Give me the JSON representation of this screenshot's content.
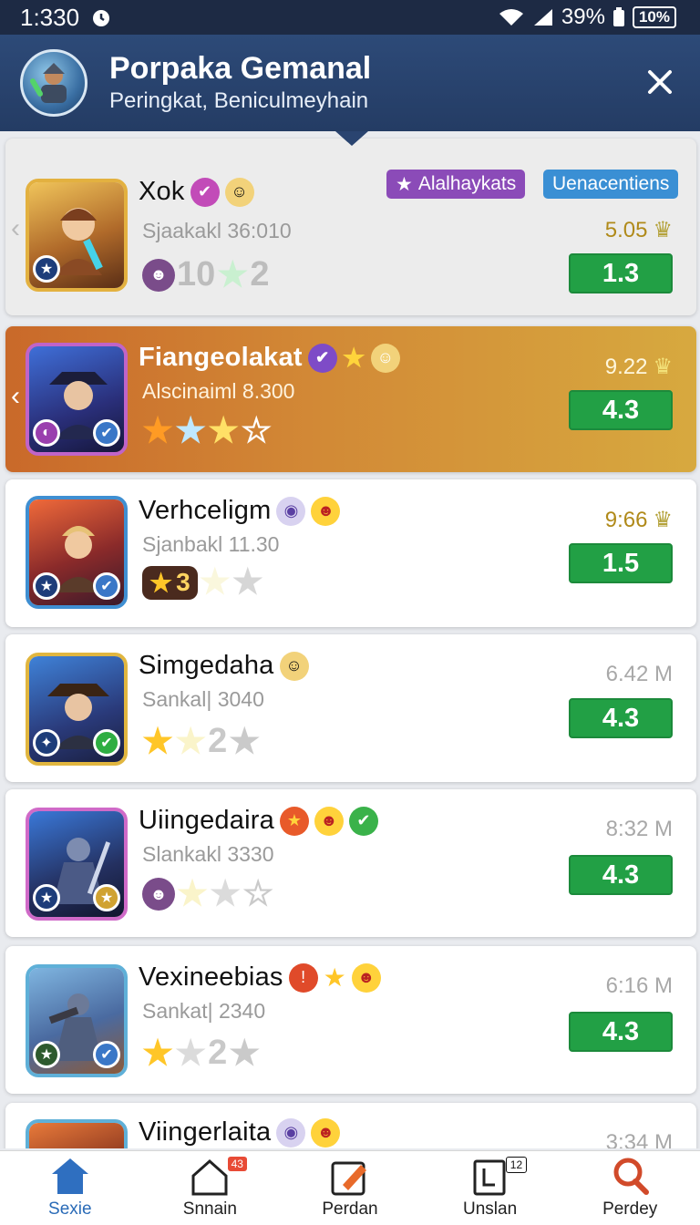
{
  "status": {
    "time": "1:330",
    "battery_pct": "39%",
    "battery_box": "10%"
  },
  "header": {
    "title": "Porpaka Gemanal",
    "subtitle": "Peringkat, Beniculmeyhain"
  },
  "tags": {
    "purple": "Alalhaykats",
    "blue": "Uenacentiens"
  },
  "rows": [
    {
      "name": "Xok",
      "sub": "Sjaakakl 36:010",
      "metric": "5.05",
      "score": "1.3",
      "stars_text": "10",
      "stars_suffix": "2"
    },
    {
      "name": "Fiangeolakat",
      "sub": "Alscinaiml 8.300",
      "metric": "9.22",
      "score": "4.3"
    },
    {
      "name": "Verhceligm",
      "sub": "Sjanbakl 11.30",
      "metric": "9:66",
      "score": "1.5",
      "level": "3"
    },
    {
      "name": "Simgedaha",
      "sub": "Sankal| 3040",
      "metric": "6.42 M",
      "score": "4.3",
      "stars_suffix": "2"
    },
    {
      "name": "Uiingedaira",
      "sub": "Slankakl 3330",
      "metric": "8:32 M",
      "score": "4.3"
    },
    {
      "name": "Vexineebias",
      "sub": "Sankat| 2340",
      "metric": "6:16 M",
      "score": "4.3",
      "stars_suffix": "2"
    },
    {
      "name": "Viingerlaita",
      "sub": "",
      "metric": "3:34 M",
      "score": ""
    }
  ],
  "tabs": [
    {
      "label": "Sexie",
      "icon": "home-icon",
      "active": true
    },
    {
      "label": "Snnain",
      "icon": "house-outline-icon",
      "count": "43"
    },
    {
      "label": "Perdan",
      "icon": "edit-icon"
    },
    {
      "label": "Unslan",
      "icon": "book-icon",
      "count": "12"
    },
    {
      "label": "Perdey",
      "icon": "search-icon"
    }
  ],
  "colors": {
    "header": "#2d4a78",
    "score_green": "#22a045",
    "accent_blue": "#2a6bb7"
  }
}
